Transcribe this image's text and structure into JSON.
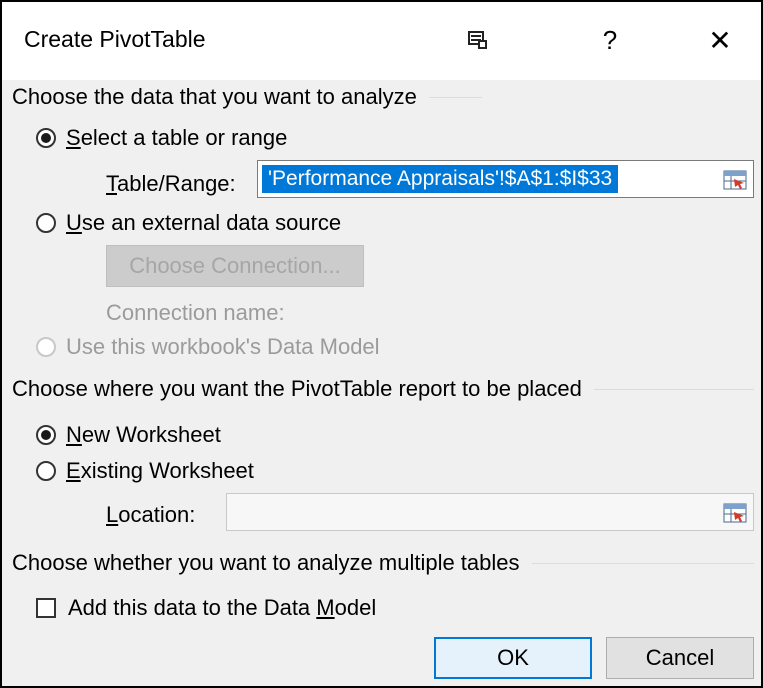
{
  "dialog": {
    "title": "Create PivotTable",
    "help_label": "?",
    "close_label": "✕"
  },
  "analyze_section": {
    "heading": "Choose the data that you want to analyze",
    "select_range": {
      "access_key": "S",
      "rest": "elect a table or range",
      "checked": true
    },
    "table_range": {
      "access_key": "T",
      "rest": "able/Range:",
      "value": "'Performance Appraisals'!$A$1:$I$33"
    },
    "external_source": {
      "access_key": "U",
      "rest": "se an external data source",
      "checked": false
    },
    "choose_connection_label": "Choose Connection...",
    "connection_name_label": "Connection name:",
    "data_model": {
      "label": "Use this workbook's Data Model",
      "enabled": false
    }
  },
  "placement_section": {
    "heading": "Choose where you want the PivotTable report to be placed",
    "new_worksheet": {
      "access_key": "N",
      "rest": "ew Worksheet",
      "checked": true
    },
    "existing_worksheet": {
      "access_key": "E",
      "rest": "xisting Worksheet",
      "checked": false
    },
    "location": {
      "access_key": "L",
      "rest": "ocation:",
      "value": ""
    }
  },
  "multiple_section": {
    "heading": "Choose whether you want to analyze multiple tables",
    "add_to_model": {
      "before": "Add this data to the Data ",
      "access_key": "M",
      "after": "odel",
      "checked": false
    }
  },
  "buttons": {
    "ok": "OK",
    "cancel": "Cancel"
  },
  "colors": {
    "accent": "#0078d7",
    "dialog_bg": "#f0f0f0",
    "disabled_text": "#9b9b9b"
  },
  "icons": {
    "titlebar": "present-online-icon",
    "range_picker": "collapse-dialog-icon"
  }
}
